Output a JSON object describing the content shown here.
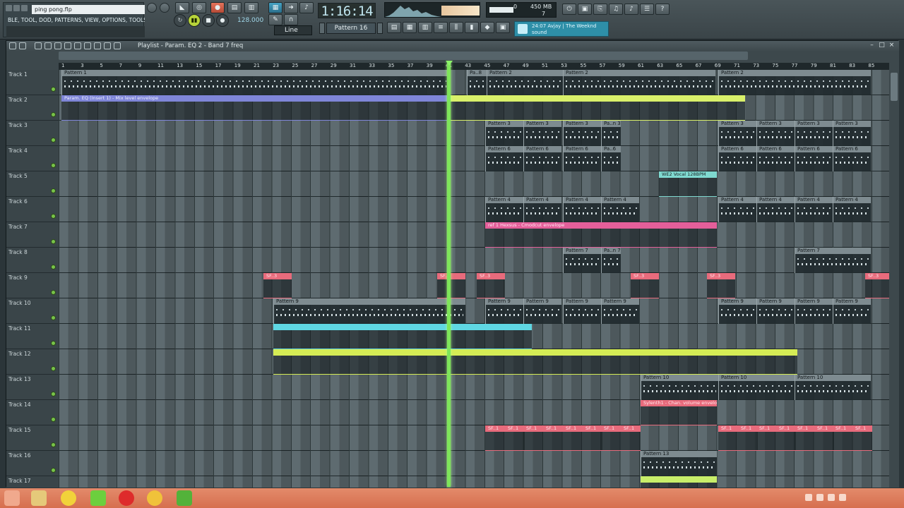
{
  "app": {
    "file_name": "ping pong.flp",
    "hint_text": "BLE, TOOL, DOD, PATTERNS, VIEW, OPTIONS, TOOLS, HELP",
    "tempo": "128.000",
    "time": "1:16:14",
    "pattern": "Pattern 16",
    "snap": "Line",
    "cpu": "0",
    "memory": "450 MB",
    "polyphony": "7",
    "news_line1": "24:07 Avjay | The Weeknd",
    "news_line2": "sound"
  },
  "playlist": {
    "title": "Playlist - Param. EQ 2 - Band 7 freq",
    "ruler_numbers": [
      "1",
      "3",
      "5",
      "7",
      "9",
      "11",
      "13",
      "15",
      "17",
      "19",
      "21",
      "23",
      "25",
      "27",
      "29",
      "31",
      "33",
      "35",
      "37",
      "39",
      "41",
      "43",
      "45",
      "47",
      "49",
      "51",
      "53",
      "55",
      "57",
      "59",
      "61",
      "63",
      "65",
      "67",
      "69",
      "71",
      "73",
      "75",
      "77",
      "79",
      "81",
      "83",
      "85"
    ],
    "tracks": [
      "Track 1",
      "Track 2",
      "Track 3",
      "Track 4",
      "Track 5",
      "Track 6",
      "Track 7",
      "Track 8",
      "Track 9",
      "Track 10",
      "Track 11",
      "Track 12",
      "Track 13",
      "Track 14",
      "Track 15",
      "Track 16",
      "Track 17"
    ],
    "clips": {
      "pattern1": "Pattern 1",
      "pattern2": "Pattern 2",
      "pattern3": "Pattern 3",
      "pattern4": "Pattern 4",
      "pattern6": "Pattern 6",
      "pattern7": "Pattern 7",
      "pattern9": "Pattern 9",
      "pattern10": "Pattern 10",
      "pattern13": "Pattern 13",
      "pa_n3": "Pa..n 3",
      "pa_6": "Pa..6",
      "pa_n7": "Pa..n 7",
      "pa_8": "Pa..8",
      "env_track2": "Param. EQ (Insert 1) - Mix level envelope",
      "env_track7": "ref 1 Hexsus - Cmodcut envelope",
      "env_track14": "Sylenth1 - Chan. volume envelope",
      "audio_track5": "WE2 Vocal 128BPM",
      "sf_short": "SF..3",
      "sf_long": "SF..1"
    }
  },
  "colors": {
    "accent_green": "#7ee55a",
    "env_lilac": "#7f86d8",
    "env_lime": "#d9f06a",
    "env_pink": "#e45f9a",
    "env_cyan": "#5fd7e3",
    "env_yellow": "#d5ec55",
    "env_salmon": "#e86b7c"
  },
  "icons": [
    "play-icon",
    "stop-icon",
    "record-icon",
    "pattern-icon",
    "mixer-icon",
    "browser-icon",
    "piano-roll-icon",
    "help-icon",
    "magnet-icon",
    "pencil-icon"
  ]
}
